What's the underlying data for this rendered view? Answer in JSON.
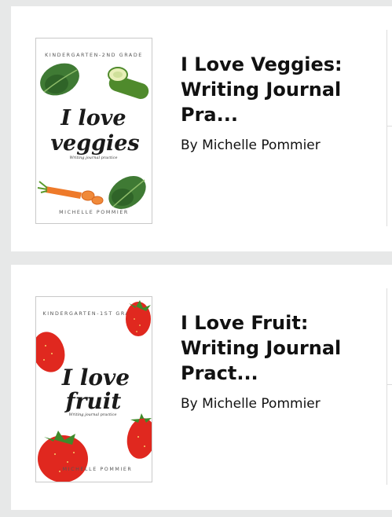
{
  "books": [
    {
      "title": "I Love Veggies:\nWriting Journal\nPra...",
      "author": "By Michelle Pommier",
      "cover": {
        "top_text": "KINDERGARTEN-2ND GRADE",
        "line1": "I love",
        "line2": "veggies",
        "subtitle": "Writing journal practice",
        "author": "MICHELLE POMMIER"
      }
    },
    {
      "title": "I Love Fruit:\nWriting Journal\nPract...",
      "author": "By Michelle Pommier",
      "cover": {
        "top_text": "KINDERGARTEN-1ST GRADE",
        "line1": "I love",
        "line2": "fruit",
        "subtitle": "Writing journal practice",
        "author": "MICHELLE POMMIER"
      }
    }
  ],
  "colors": {
    "page_bg": "#e7e8e8",
    "card_bg": "#ffffff",
    "text": "#111111",
    "spinach": "#3f7a34",
    "cucumber": "#4f8a2c",
    "carrot": "#ee7a2a",
    "strawberry": "#e0281f"
  }
}
